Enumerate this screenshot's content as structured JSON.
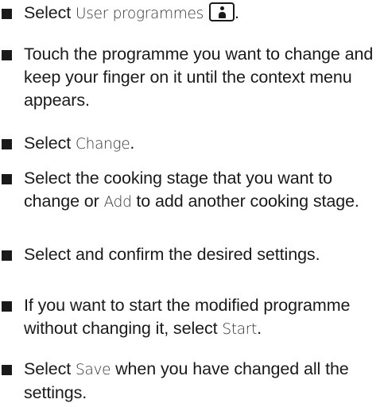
{
  "steps": [
    {
      "pre": "Select ",
      "ui": "User programmes",
      "icon": "user-programmes-icon",
      "post": "."
    },
    {
      "text": "Touch the programme you want to change and keep your finger on it until the context menu appears."
    },
    {
      "pre": "Select ",
      "ui": "Change",
      "post": "."
    },
    {
      "pre": "Select the cooking stage that you want to change or ",
      "ui": "Add",
      "post": " to add another cooking stage."
    },
    {
      "text": "Select and confirm the desired set­tings."
    },
    {
      "pre": "If you want to start the modified pro­gramme without changing it, se­lect ",
      "ui": "Start",
      "post": "."
    },
    {
      "pre": "Select ",
      "ui": "Save",
      "post": " when you have changed all the settings."
    }
  ]
}
